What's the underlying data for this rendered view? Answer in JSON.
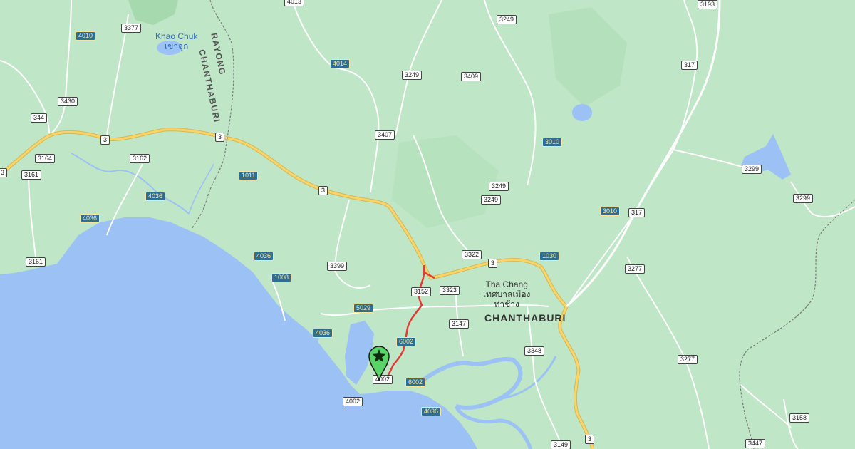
{
  "map": {
    "colors": {
      "land": "#bfe6c6",
      "water": "#9cc1f4",
      "major_road": "#f7d56c",
      "minor_road": "#ffffff",
      "route": "#e53935",
      "border": "#7b7b7b",
      "marker": "#58d468"
    },
    "labels": {
      "khao_chuk": "Khao Chuk",
      "khao_chuk_thai": "เขาจุก",
      "chanthaburi_border": "CHANTHABURI",
      "rayong_border": "RAYONG",
      "tha_chang": "Tha Chang",
      "tha_chang_thai": "เทศบาลเมือง",
      "tha_chang_thai2": "ท่าช้าง",
      "chanthaburi_city": "CHANTHABURI"
    },
    "road_shields": {
      "r4013": "4013",
      "r3193": "3193",
      "r4010": "4010",
      "r3377": "3377",
      "r3249a": "3249",
      "r4014": "4014",
      "r3249b": "3249",
      "r3409": "3409",
      "r317a": "317",
      "r3430": "3430",
      "r344": "344",
      "r3407": "3407",
      "r3a": "3",
      "r3b": "3",
      "r3010a": "3010",
      "r3164": "3164",
      "r3162": "3162",
      "r3161a": "3161",
      "r3c": "3",
      "r1011": "1011",
      "r3d": "3",
      "r3249c": "3249",
      "r3249d": "3249",
      "r3299a": "3299",
      "r4036a": "4036",
      "r4036b": "4036",
      "r3010b": "3010",
      "r317b": "317",
      "r3299b": "3299",
      "r3322": "3322",
      "r1030": "1030",
      "r3161b": "3161",
      "r4036c": "4036",
      "r3399": "3399",
      "r3e": "3",
      "r3277a": "3277",
      "r1008": "1008",
      "r3152": "3152",
      "r3323": "3323",
      "r5029": "5029",
      "r3147": "3147",
      "r4036d": "4036",
      "r6002a": "6002",
      "r3348": "3348",
      "r4002a": "4002",
      "r6002b": "6002",
      "r3277b": "3277",
      "r4002b": "4002",
      "r4036e": "4036",
      "r3158": "3158",
      "r3f": "3",
      "r3149": "3149",
      "r3447": "3447"
    },
    "marker_icon": "star-pin-icon"
  }
}
